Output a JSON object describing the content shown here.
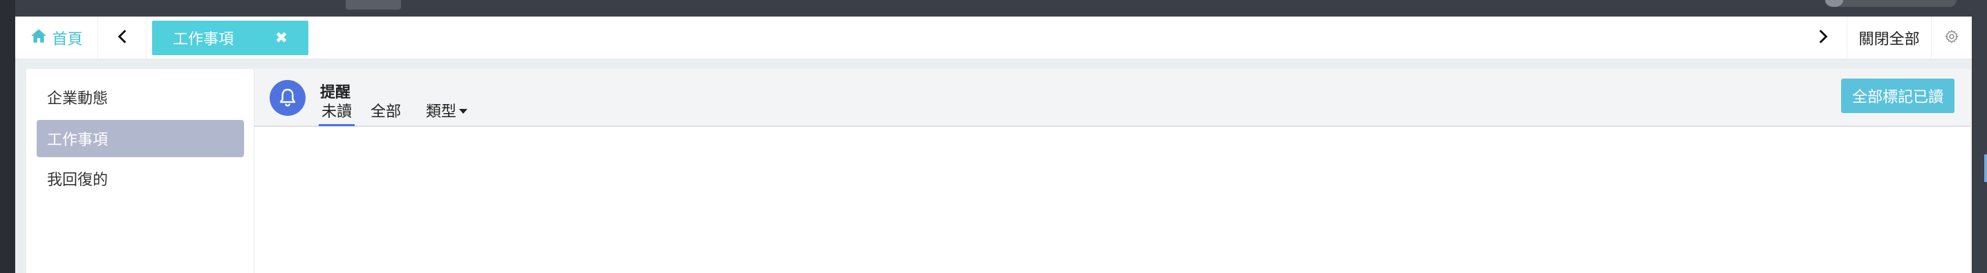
{
  "tabbar": {
    "home_label": "首頁",
    "active_tab_label": "工作事項",
    "close_tab_symbol": "✖",
    "close_all_label": "關閉全部"
  },
  "sidebar": {
    "items": [
      {
        "label": "企業動態",
        "active": false
      },
      {
        "label": "工作事項",
        "active": true
      },
      {
        "label": "我回復的",
        "active": false
      }
    ]
  },
  "main": {
    "title": "提醒",
    "tabs": [
      {
        "label": "未讀",
        "active": true
      },
      {
        "label": "全部",
        "active": false
      },
      {
        "label": "類型",
        "active": false
      }
    ],
    "mark_all_read_label": "全部標記已讀"
  },
  "icons": [
    "home-icon",
    "chevron-left-icon",
    "close-icon",
    "chevron-right-icon",
    "gear-icon",
    "bell-icon",
    "caret-down-icon"
  ],
  "colors": {
    "accent": "#4fd0dc",
    "home": "#45c2d3",
    "active_sidebar": "#b1b7cd",
    "bell_bg": "#4f73de",
    "mark_all_btn": "#5bc2dc"
  }
}
